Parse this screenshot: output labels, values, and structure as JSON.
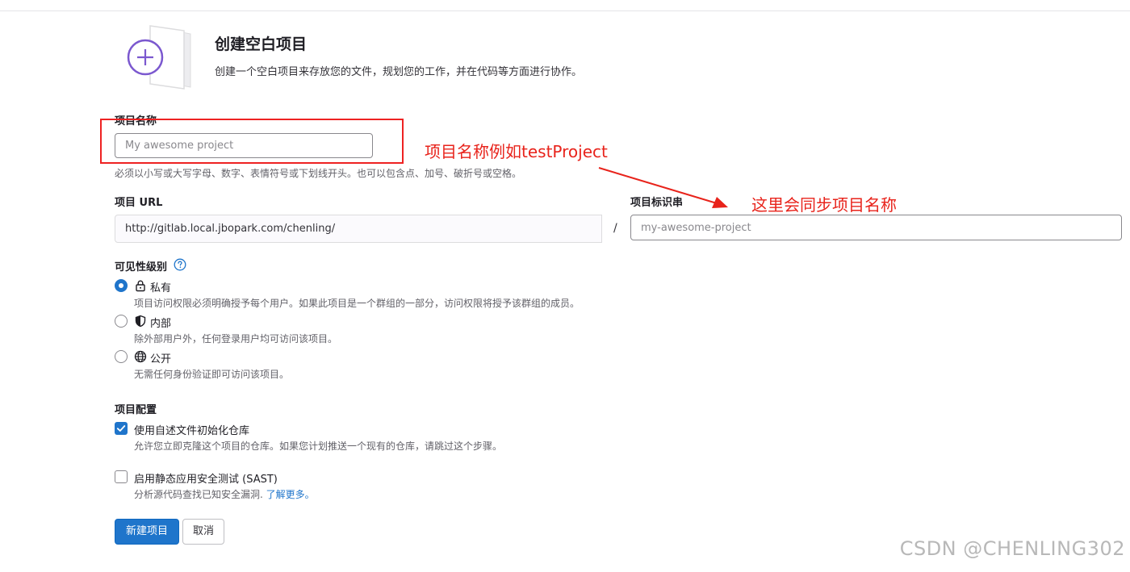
{
  "header": {
    "title": "创建空白项目",
    "description": "创建一个空白项目来存放您的文件，规划您的工作，并在代码等方面进行协作。"
  },
  "project_name": {
    "label": "项目名称",
    "placeholder": "My awesome project",
    "help": "必须以小写或大写字母、数字、表情符号或下划线开头。也可以包含点、加号、破折号或空格。"
  },
  "project_url": {
    "label": "项目 URL",
    "value": "http://gitlab.local.jbopark.com/chenling/",
    "separator": "/"
  },
  "project_slug": {
    "label": "项目标识串",
    "placeholder": "my-awesome-project"
  },
  "visibility": {
    "label": "可见性级别",
    "options": [
      {
        "label": "私有",
        "icon": "lock-icon",
        "description": "项目访问权限必须明确授予每个用户。如果此项目是一个群组的一部分，访问权限将授予该群组的成员。",
        "checked": true
      },
      {
        "label": "内部",
        "icon": "shield-icon",
        "description": "除外部用户外，任何登录用户均可访问该项目。",
        "checked": false
      },
      {
        "label": "公开",
        "icon": "globe-icon",
        "description": "无需任何身份验证即可访问该项目。",
        "checked": false
      }
    ]
  },
  "config": {
    "label": "项目配置",
    "readme": {
      "label": "使用自述文件初始化仓库",
      "description": "允许您立即克隆这个项目的仓库。如果您计划推送一个现有的仓库，请跳过这个步骤。",
      "checked": true
    },
    "sast": {
      "label": "启用静态应用安全测试 (SAST)",
      "description": "分析源代码查找已知安全漏洞.",
      "link": "了解更多。",
      "checked": false
    }
  },
  "actions": {
    "create": "新建项目",
    "cancel": "取消"
  },
  "annotations": {
    "name_note": "项目名称例如testProject",
    "slug_note": "这里会同步项目名称"
  },
  "watermark": "CSDN @CHENLING302",
  "colors": {
    "primary": "#1f75cb",
    "annotation_red": "#e8231b",
    "illustration_purple": "#7b58cf"
  }
}
